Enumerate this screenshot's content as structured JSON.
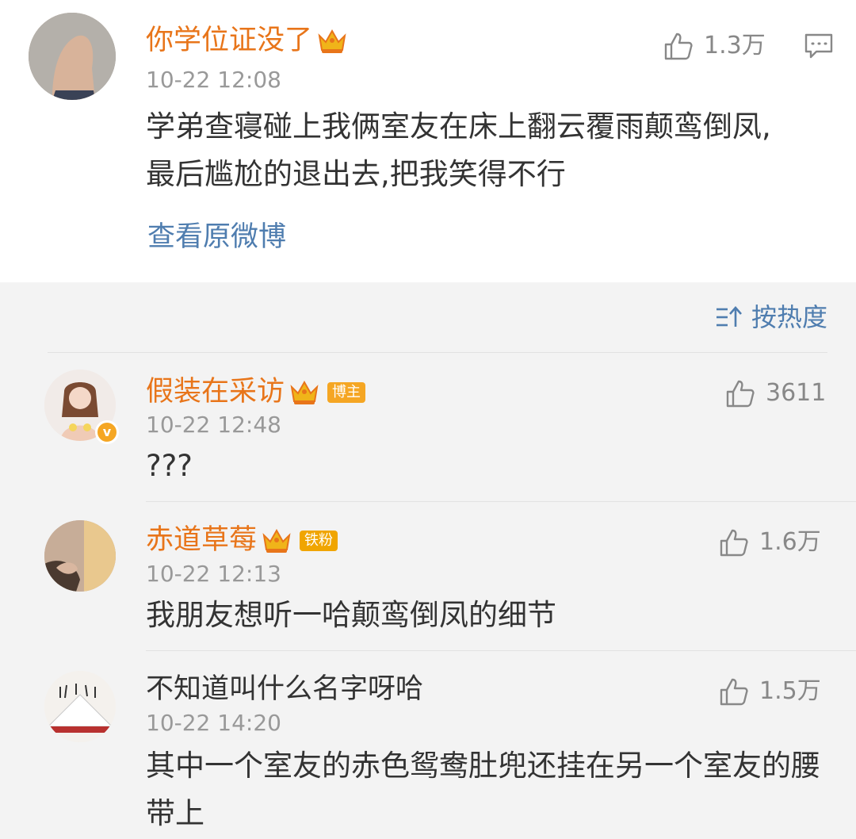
{
  "main_post": {
    "username": "你学位证没了",
    "timestamp": "10-22 12:08",
    "likes": "1.3万",
    "content_line1": "学弟查寝碰上我俩室友在床上翻云覆雨颠鸾倒凤,",
    "content_line2": "最后尴尬的退出去,把我笑得不行",
    "view_original_label": "查看原微博"
  },
  "sort": {
    "label": "按热度"
  },
  "comments": [
    {
      "username": "假装在采访",
      "badge": "博主",
      "timestamp": "10-22 12:48",
      "likes": "3611",
      "content": "???"
    },
    {
      "username": "赤道草莓",
      "badge": "铁粉",
      "timestamp": "10-22 12:13",
      "likes": "1.6万",
      "content": "我朋友想听一哈颠鸾倒凤的细节"
    },
    {
      "username": "不知道叫什么名字呀哈",
      "timestamp": "10-22 14:20",
      "likes": "1.5万",
      "content_line1": "其中一个室友的赤色鸳鸯肚兜还挂在另一个室友的腰",
      "content_line2": "带上"
    }
  ],
  "colors": {
    "username": "#e8751a",
    "link": "#4f7daf",
    "timestamp": "#999999",
    "text": "#333333"
  },
  "icons": [
    "crown-icon",
    "thumbs-up-icon",
    "comment-icon",
    "sort-icon",
    "verified-icon"
  ]
}
